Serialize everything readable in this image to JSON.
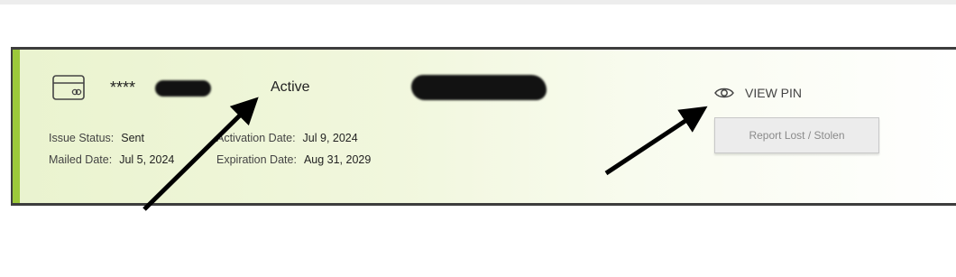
{
  "card": {
    "masked_number": "****",
    "status": "Active",
    "details": {
      "issue_status_label": "Issue Status:",
      "issue_status_value": "Sent",
      "mailed_date_label": "Mailed Date:",
      "mailed_date_value": "Jul 5, 2024",
      "activation_date_label": "Activation Date:",
      "activation_date_value": "Jul 9, 2024",
      "expiration_date_label": "Expiration Date:",
      "expiration_date_value": "Aug 31, 2029"
    }
  },
  "actions": {
    "view_pin_label": "VIEW PIN",
    "report_lost_label": "Report Lost / Stolen"
  },
  "colors": {
    "accent": "#9cc93a",
    "border": "#3d3d3d",
    "button_bg": "#ececec"
  },
  "icons": [
    "credit-card-icon",
    "eye-icon"
  ]
}
